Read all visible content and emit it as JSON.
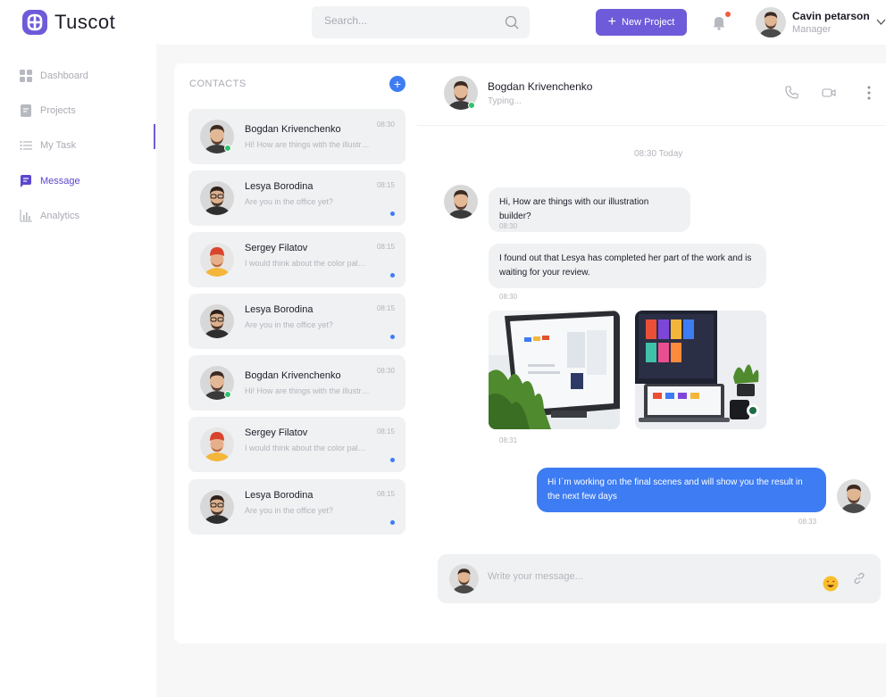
{
  "brand": {
    "name": "Tuscot",
    "accent": "#6e5bd9",
    "blue": "#3d7cf2"
  },
  "header": {
    "search_placeholder": "Search...",
    "new_project_label": "New Project",
    "user": {
      "name": "Cavin petarson",
      "role": "Manager"
    }
  },
  "sidebar": {
    "items": [
      {
        "label": "Dashboard",
        "icon": "grid-icon"
      },
      {
        "label": "Projects",
        "icon": "document-icon"
      },
      {
        "label": "My Task",
        "icon": "list-icon"
      },
      {
        "label": "Message",
        "icon": "chat-icon",
        "active": true
      },
      {
        "label": "Analytics",
        "icon": "bar-chart-icon"
      }
    ]
  },
  "contacts": {
    "title": "CONTACTS",
    "items": [
      {
        "name": "Bogdan Krivenchenko",
        "preview": "Hi! How are things with the illustration builder?",
        "time": "08:30",
        "online": true
      },
      {
        "name": "Lesya Borodina",
        "preview": "Are you in the office yet?",
        "time": "08:15",
        "unread": true
      },
      {
        "name": "Sergey Filatov",
        "preview": "I would think about the color palette",
        "time": "08:15",
        "unread": true
      },
      {
        "name": "Lesya Borodina",
        "preview": "Are you in the office yet?",
        "time": "08:15",
        "unread": true
      },
      {
        "name": "Bogdan Krivenchenko",
        "preview": "Hi! How are things with the illustration builder?",
        "time": "08:30",
        "online": true
      },
      {
        "name": "Sergey Filatov",
        "preview": "I would think about the color palette",
        "time": "08:15",
        "unread": true
      },
      {
        "name": "Lesya Borodina",
        "preview": "Are you in the office yet?",
        "time": "08:15",
        "unread": true
      }
    ]
  },
  "chat": {
    "name": "Bogdan Krivenchenko",
    "status": "Typing...",
    "date_separator": "08:30 Today",
    "messages": [
      {
        "text": "Hi, How are things with our illustration builder?",
        "time": "08:30"
      },
      {
        "text": "I found out that Lesya has completed her part of the work and is waiting for your review.",
        "time": "08:30"
      },
      {
        "attachments": 2,
        "time": "08:31"
      },
      {
        "text": "Hi I`m working on the final scenes and will show you the result in the next few days",
        "time": "08:33",
        "mine": true
      }
    ],
    "composer_placeholder": "Write your message..."
  }
}
